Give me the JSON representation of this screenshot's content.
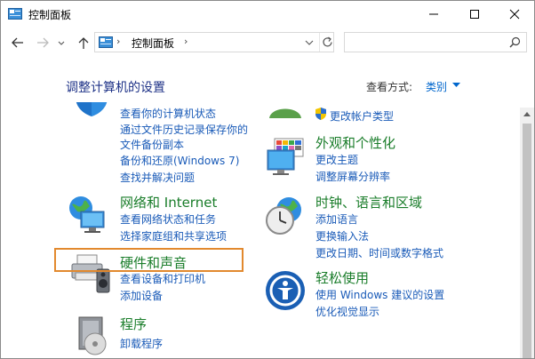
{
  "window": {
    "title": "控制面板",
    "app_icon": "control-panel-icon"
  },
  "address_bar": {
    "separator": "›",
    "path_text": "控制面板",
    "crumb_arrow": "›"
  },
  "search": {
    "placeholder": "",
    "value": ""
  },
  "header": {
    "title": "调整计算机的设置",
    "view_label": "查看方式:",
    "view_value": "类别"
  },
  "categories": {
    "system_security": {
      "icon": "system-security-icon",
      "links": [
        "查看你的计算机状态",
        "通过文件历史记录保存你的",
        "文件备份副本",
        "备份和还原(Windows 7)",
        "查找并解决问题"
      ]
    },
    "user_accounts": {
      "icon": "user-accounts-icon",
      "links": [
        "更改帐户类型"
      ]
    },
    "network": {
      "icon": "network-icon",
      "title": "网络和 Internet",
      "links": [
        "查看网络状态和任务",
        "选择家庭组和共享选项"
      ]
    },
    "hardware": {
      "icon": "hardware-sound-icon",
      "title": "硬件和声音",
      "links": [
        "查看设备和打印机",
        "添加设备"
      ]
    },
    "programs": {
      "icon": "programs-icon",
      "title": "程序",
      "links": [
        "卸载程序"
      ]
    },
    "appearance": {
      "icon": "appearance-icon",
      "title": "外观和个性化",
      "links": [
        "更改主题",
        "调整屏幕分辨率"
      ]
    },
    "clock_region": {
      "icon": "clock-region-icon",
      "title": "时钟、语言和区域",
      "links": [
        "添加语言",
        "更换输入法",
        "更改日期、时间或数字格式"
      ]
    },
    "ease_access": {
      "icon": "ease-of-access-icon",
      "title": "轻松使用",
      "links": [
        "使用 Windows 建议的设置",
        "优化视觉显示"
      ]
    }
  },
  "colors": {
    "category_title": "#1a7d2a",
    "link": "#1a5bb8",
    "heading": "#1e3287",
    "highlight": "#e2892e"
  }
}
